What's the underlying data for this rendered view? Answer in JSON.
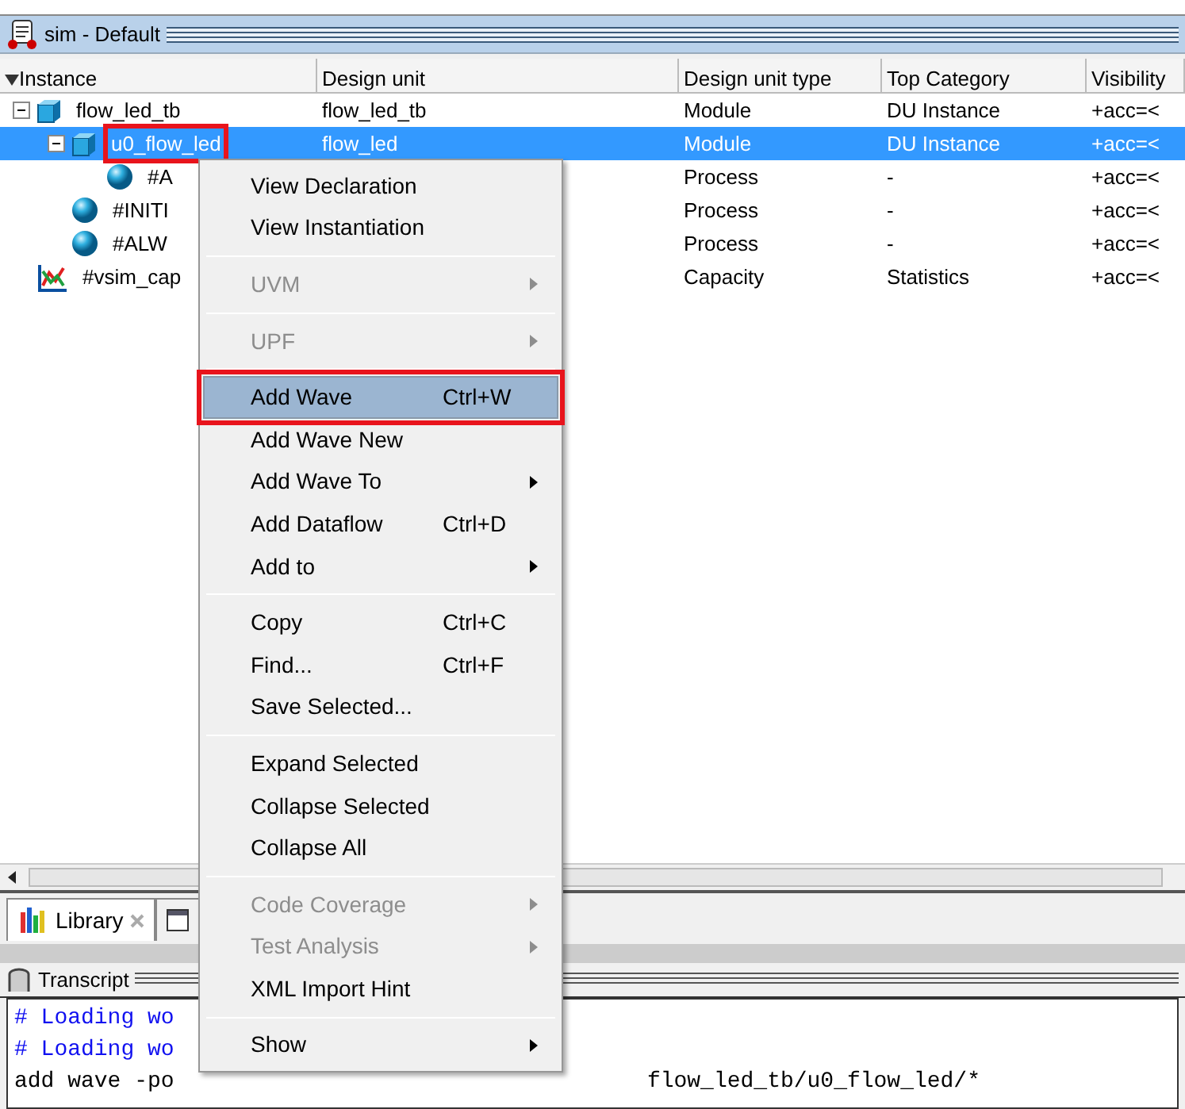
{
  "panel": {
    "title": "sim - Default"
  },
  "table": {
    "columns": [
      "Instance",
      "Design unit",
      "Design unit type",
      "Top Category",
      "Visibility"
    ],
    "rows": [
      {
        "kind": "module",
        "cells": [
          "flow_led_tb",
          "flow_led_tb",
          "Module",
          "DU Instance",
          "+acc=<"
        ],
        "expanded": true,
        "selected": false,
        "annotated": false,
        "children": [
          {
            "kind": "module",
            "cells": [
              "u0_flow_led",
              "flow_led",
              "Module",
              "DU Instance",
              "+acc=<"
            ],
            "expanded": true,
            "selected": true,
            "annotated": true,
            "children": [
              {
                "kind": "process",
                "cells": [
                  "#A",
                  "",
                  "Process",
                  "-",
                  "+acc=<"
                ],
                "selected": false,
                "annotated": false
              }
            ]
          },
          {
            "kind": "process",
            "cells": [
              "#INITI",
              "",
              "Process",
              "-",
              "+acc=<"
            ],
            "selected": false,
            "annotated": false
          },
          {
            "kind": "process",
            "cells": [
              "#ALW",
              "",
              "Process",
              "-",
              "+acc=<"
            ],
            "selected": false,
            "annotated": false
          }
        ]
      },
      {
        "kind": "capacity",
        "cells": [
          "#vsim_cap",
          "",
          "Capacity",
          "Statistics",
          "+acc=<"
        ],
        "selected": false,
        "annotated": false
      }
    ]
  },
  "bottom_tabs": [
    {
      "label": "Library",
      "selected": true
    }
  ],
  "transcript": {
    "title": "Transcript",
    "lines": [
      {
        "kind": "comment",
        "text": "# Loading wo"
      },
      {
        "kind": "comment",
        "text": "# Loading wo"
      },
      {
        "kind": "command",
        "text": "add wave -po",
        "tail": "flow_led_tb/u0_flow_led/*"
      }
    ]
  },
  "context_menu": [
    {
      "kind": "item",
      "label": "View Declaration",
      "disabled": false,
      "submenu": false,
      "hovered": false,
      "annotated": false
    },
    {
      "kind": "item",
      "label": "View Instantiation",
      "disabled": false,
      "submenu": false,
      "hovered": false,
      "annotated": false
    },
    {
      "kind": "separator"
    },
    {
      "kind": "item",
      "label": "UVM",
      "disabled": true,
      "submenu": true,
      "hovered": false,
      "annotated": false
    },
    {
      "kind": "separator"
    },
    {
      "kind": "item",
      "label": "UPF",
      "disabled": true,
      "submenu": true,
      "hovered": false,
      "annotated": false
    },
    {
      "kind": "separator"
    },
    {
      "kind": "item",
      "label": "Add Wave",
      "shortcut": "Ctrl+W",
      "disabled": false,
      "submenu": false,
      "hovered": true,
      "annotated": true
    },
    {
      "kind": "item",
      "label": "Add Wave New",
      "disabled": false,
      "submenu": false,
      "hovered": false,
      "annotated": false
    },
    {
      "kind": "item",
      "label": "Add Wave To",
      "disabled": false,
      "submenu": true,
      "hovered": false,
      "annotated": false
    },
    {
      "kind": "item",
      "label": "Add Dataflow",
      "shortcut": "Ctrl+D",
      "disabled": false,
      "submenu": false,
      "hovered": false,
      "annotated": false
    },
    {
      "kind": "item",
      "label": "Add to",
      "disabled": false,
      "submenu": true,
      "hovered": false,
      "annotated": false
    },
    {
      "kind": "separator"
    },
    {
      "kind": "item",
      "label": "Copy",
      "shortcut": "Ctrl+C",
      "disabled": false,
      "submenu": false,
      "hovered": false,
      "annotated": false
    },
    {
      "kind": "item",
      "label": "Find...",
      "shortcut": "Ctrl+F",
      "disabled": false,
      "submenu": false,
      "hovered": false,
      "annotated": false
    },
    {
      "kind": "item",
      "label": "Save Selected...",
      "disabled": false,
      "submenu": false,
      "hovered": false,
      "annotated": false
    },
    {
      "kind": "separator"
    },
    {
      "kind": "item",
      "label": "Expand Selected",
      "disabled": false,
      "submenu": false,
      "hovered": false,
      "annotated": false
    },
    {
      "kind": "item",
      "label": "Collapse Selected",
      "disabled": false,
      "submenu": false,
      "hovered": false,
      "annotated": false
    },
    {
      "kind": "item",
      "label": "Collapse All",
      "disabled": false,
      "submenu": false,
      "hovered": false,
      "annotated": false
    },
    {
      "kind": "separator"
    },
    {
      "kind": "item",
      "label": "Code Coverage",
      "disabled": true,
      "submenu": true,
      "hovered": false,
      "annotated": false
    },
    {
      "kind": "item",
      "label": "Test Analysis",
      "disabled": true,
      "submenu": true,
      "hovered": false,
      "annotated": false
    },
    {
      "kind": "item",
      "label": "XML Import Hint",
      "disabled": false,
      "submenu": false,
      "hovered": false,
      "annotated": false
    },
    {
      "kind": "separator"
    },
    {
      "kind": "item",
      "label": "Show",
      "disabled": false,
      "submenu": true,
      "hovered": false,
      "annotated": false
    }
  ]
}
